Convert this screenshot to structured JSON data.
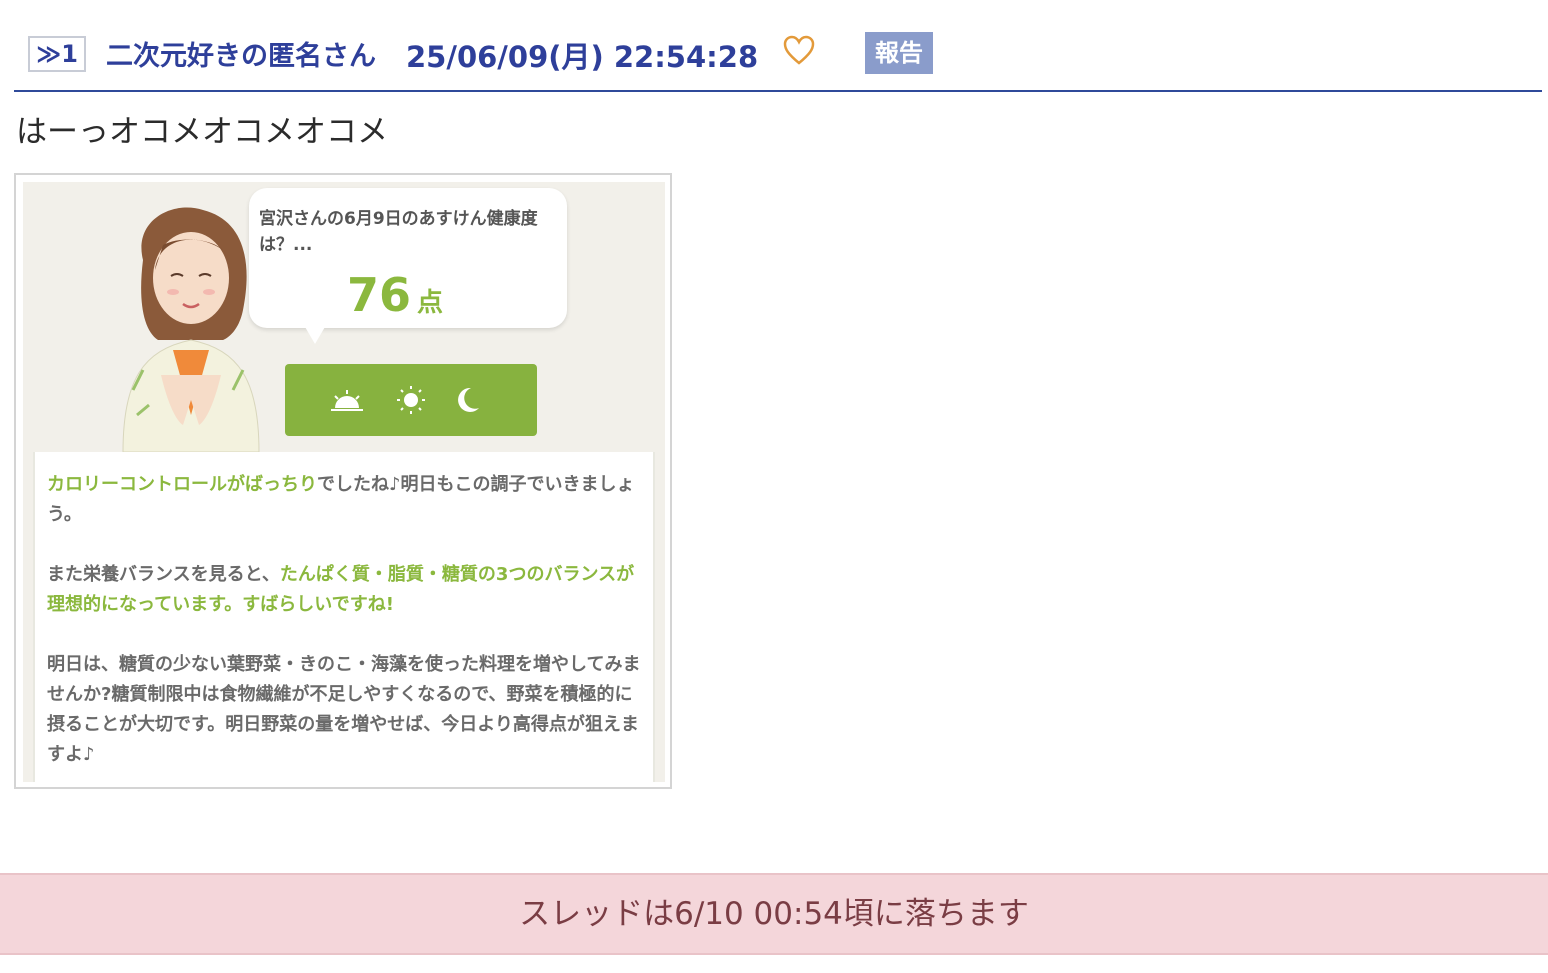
{
  "post": {
    "anchor_label": "≫1",
    "poster_name": "二次元好きの匿名さん",
    "date": "25/06/09(月) 22:54:28",
    "heart_icon": "heart-outline-icon",
    "report_label": "報告",
    "body": "はーっオコメオコメオコメ"
  },
  "image": {
    "bubble_text": "宮沢さんの6月9日のあすけん健康度は？...",
    "score": "76",
    "score_unit": "点",
    "time_icons": [
      "sunrise-icon",
      "sun-icon",
      "moon-icon"
    ],
    "para1_highlight": "カロリーコントロールがばっちり",
    "para1_rest": "でしたね♪明日もこの調子でいきましょう。",
    "para2_start": "また栄養バランスを見ると、",
    "para2_highlight": "たんぱく質・脂質・糖質の3つのバランスが理想的になっています。すばらしいですね!",
    "para3": "明日は、糖質の少ない葉野菜・きのこ・海藻を使った料理を増やしてみませんか?糖質制限中は食物繊維が不足しやすくなるので、野菜を積極的に摂ることが大切です。明日野菜の量を増やせば、今日より高得点が狙えますよ♪"
  },
  "thread_notice": "スレッドは6/10 00:54頃に落ちます",
  "colors": {
    "link_blue": "#2e3f9a",
    "report_bg": "#8a9ccb",
    "accent_green": "#8bb83e",
    "notice_bg": "#f4d6da"
  }
}
